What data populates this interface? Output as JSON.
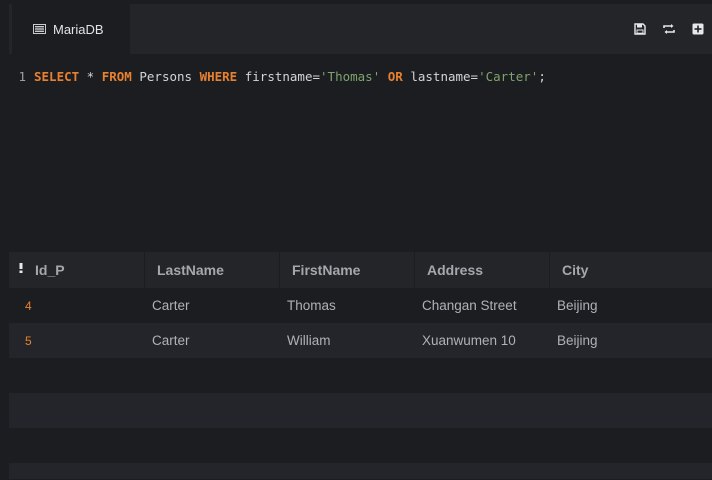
{
  "tab": {
    "label": "MariaDB"
  },
  "toolbar": {
    "buttons": [
      {
        "name": "save",
        "icon": "save-icon"
      },
      {
        "name": "refresh",
        "icon": "refresh-icon"
      },
      {
        "name": "add",
        "icon": "plus-square-icon"
      }
    ]
  },
  "editor": {
    "line_number": "1",
    "tokens": {
      "t1": "SELECT",
      "t2": " * ",
      "t3": "FROM",
      "t4": " Persons ",
      "t5": "WHERE",
      "t6": " firstname=",
      "t7": "'Thomas'",
      "t8": " ",
      "t9": "OR",
      "t10": " lastname=",
      "t11": "'Carter'",
      "t12": ";"
    }
  },
  "results": {
    "columns": [
      "Id_P",
      "LastName",
      "FirstName",
      "Address",
      "City"
    ],
    "rows": [
      [
        "4",
        "Carter",
        "Thomas",
        "Changan Street",
        "Beijing"
      ],
      [
        "5",
        "Carter",
        "William",
        "Xuanwumen 10",
        "Beijing"
      ]
    ]
  },
  "colors": {
    "background": "#1b1d21",
    "keyword": "#e8812f",
    "string": "#7fa36d",
    "text": "#d2d5d8"
  }
}
